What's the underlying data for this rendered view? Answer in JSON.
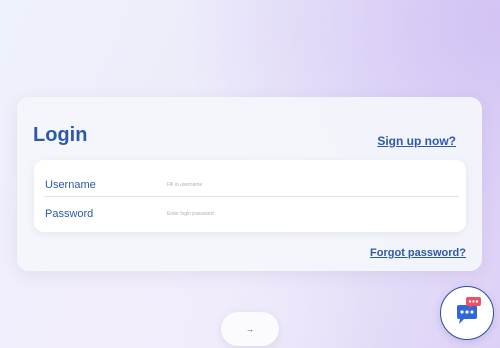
{
  "login": {
    "title": "Login",
    "signup_link": "Sign up now?",
    "username": {
      "label": "Username",
      "placeholder": "Fill in username",
      "value": ""
    },
    "password": {
      "label": "Password",
      "placeholder": "Enter login password",
      "value": ""
    },
    "forgot_link": "Forgot password?"
  },
  "submit": {
    "icon": "arrow-right-icon",
    "glyph": "→"
  },
  "chat": {
    "icon": "chat-bubble-icon",
    "badge_icon": "notification-dots-icon"
  },
  "colors": {
    "accent": "#2c5aa8",
    "chat_blue": "#2f67d8",
    "chat_badge": "#ef4f67",
    "card_bg": "#f4f6fb"
  }
}
